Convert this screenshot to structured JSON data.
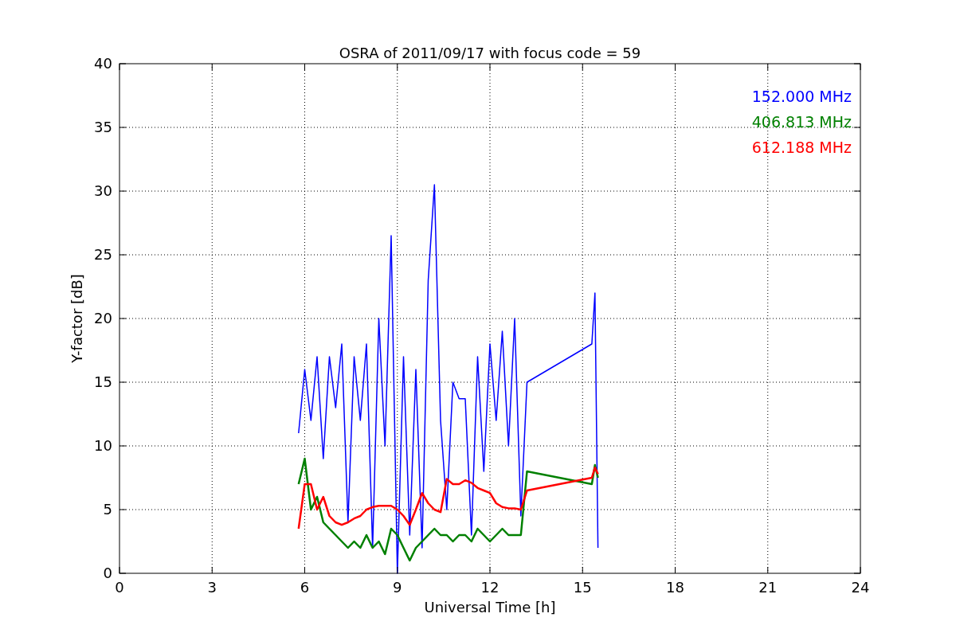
{
  "figure": {
    "chart_data": {
      "type": "line",
      "title": "OSRA of 2011/09/17 with focus code = 59",
      "xlabel": "Universal Time [h]",
      "ylabel": "Y-factor [dB]",
      "x": [
        5.8,
        6.0,
        6.2,
        6.4,
        6.6,
        6.8,
        7.0,
        7.2,
        7.4,
        7.6,
        7.8,
        8.0,
        8.2,
        8.4,
        8.6,
        8.8,
        9.0,
        9.2,
        9.4,
        9.6,
        9.8,
        10.0,
        10.2,
        10.4,
        10.6,
        10.8,
        11.0,
        11.2,
        11.4,
        11.6,
        11.8,
        12.0,
        12.2,
        12.4,
        12.6,
        12.8,
        13.0,
        13.2,
        15.3,
        15.4,
        15.5
      ],
      "series": [
        {
          "name": "152.000 MHz",
          "color": "#0000ff",
          "values": [
            11,
            16,
            12,
            17,
            9,
            17,
            13,
            18,
            4,
            17,
            12,
            18,
            2,
            20,
            10,
            26.5,
            0,
            17,
            3,
            16,
            2,
            23,
            30.5,
            12,
            5,
            15,
            13.7,
            13.7,
            3,
            17,
            8,
            18,
            12,
            19,
            10,
            20,
            4.5,
            15,
            18,
            22,
            2
          ]
        },
        {
          "name": "406.813 MHz",
          "color": "#008000",
          "values": [
            7,
            9,
            5,
            6,
            4,
            3.5,
            3,
            2.5,
            2,
            2.5,
            2,
            3,
            2,
            2.5,
            1.5,
            3.5,
            3,
            2,
            1,
            2,
            2.5,
            3,
            3.5,
            3,
            3,
            2.5,
            3,
            3,
            2.5,
            3.5,
            3,
            2.5,
            3,
            3.5,
            3,
            3,
            3,
            8,
            7,
            8.5,
            7.5
          ]
        },
        {
          "name": "612.188 MHz",
          "color": "#ff0000",
          "values": [
            3.5,
            7,
            7,
            5,
            6,
            4.5,
            4,
            3.8,
            4,
            4.3,
            4.5,
            5,
            5.2,
            5.3,
            5.3,
            5.3,
            5,
            4.5,
            3.8,
            5,
            6.3,
            5.5,
            5,
            4.8,
            7.4,
            7,
            7,
            7.3,
            7.1,
            6.7,
            6.5,
            6.3,
            5.5,
            5.2,
            5.1,
            5.1,
            5,
            6.5,
            7.5,
            8.3,
            7.8
          ]
        }
      ],
      "xlim": [
        0,
        24
      ],
      "ylim": [
        0,
        40
      ],
      "xticks": [
        0,
        3,
        6,
        9,
        12,
        15,
        18,
        21,
        24
      ],
      "yticks": [
        0,
        5,
        10,
        15,
        20,
        25,
        30,
        35,
        40
      ],
      "grid": true
    }
  }
}
